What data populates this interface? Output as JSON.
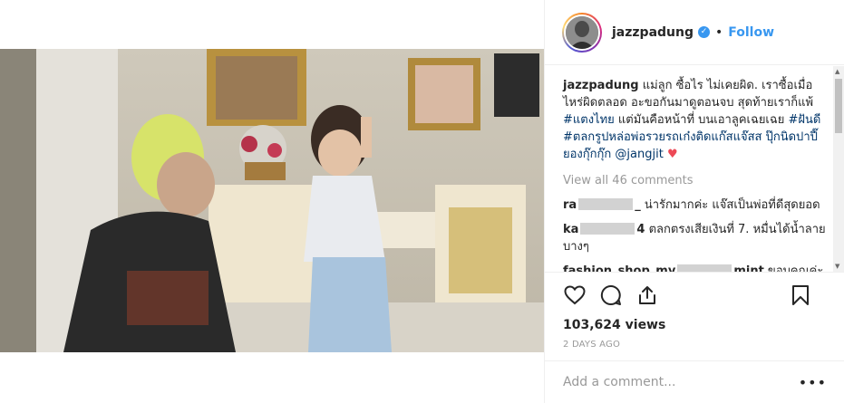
{
  "post": {
    "username": "jazzpadung",
    "verified_icon": "verified-check-icon",
    "follow_label": "Follow",
    "separator": "•"
  },
  "caption": {
    "username": "jazzpadung",
    "text_1": " แม่ลูก ซื้อไร ไม่เคยผิด. เราซื้อเมื่อไหร่ผิดตลอด อะขอกันมาดูตอนจบ สุดท้ายเราก็แพ้ ",
    "tag_1": "#แตงไทย",
    "text_2": " แต่มันคือหน้าที่ บนเอาลูคเฉยเฉย ",
    "tag_2": "#ฝันดี",
    "text_3": " ",
    "tag_3": "#ตลกรูปหล่อพ่อรวยรถเก๋งติดแก๊สแจ๊สส ปุ๊กนิดปาปี๊ยองกุ๊กกุ๊ก",
    "text_4": " ",
    "mention": "@jangjit",
    "heart": "♥"
  },
  "view_all_comments": "View all 46 comments",
  "comments": [
    {
      "user_start": "ra",
      "user_end": "_",
      "text": " น่ารักมากค่ะ แจ๊สเป็นพ่อที่ดีสุดยอด"
    },
    {
      "user_start": "ka",
      "user_end": "4",
      "text": " ตลกตรงเสียเงินที่ 7. หมื่นได้น้ำลายบางๆ"
    },
    {
      "user_start": "fashion_shop_my",
      "user_end": "mint",
      "text": " ขอบคุณค่ะปลดบล็อก"
    }
  ],
  "actions": {
    "like_icon": "heart-outline-icon",
    "comment_icon": "comment-bubble-icon",
    "share_icon": "share-arrow-icon",
    "save_icon": "bookmark-icon"
  },
  "views": "103,624 views",
  "date": "2 DAYS AGO",
  "add_comment": {
    "placeholder": "Add a comment...",
    "more": "•••"
  }
}
